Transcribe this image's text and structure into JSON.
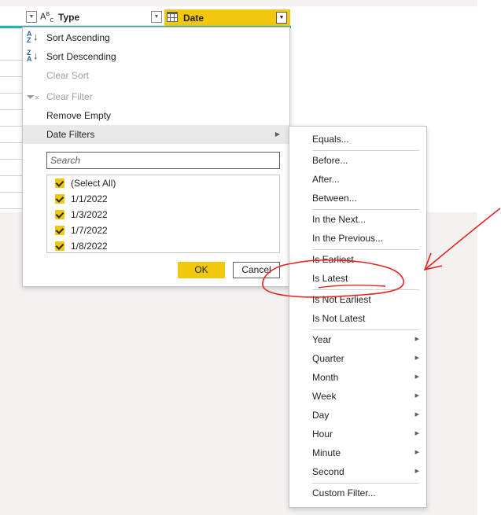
{
  "columns": {
    "type": {
      "label": "Type",
      "icon": "abc-text-type-icon"
    },
    "date": {
      "label": "Date",
      "icon": "calendar-icon"
    }
  },
  "menu": {
    "sort_ascending": "Sort Ascending",
    "sort_descending": "Sort Descending",
    "clear_sort": "Clear Sort",
    "clear_filter": "Clear Filter",
    "remove_empty": "Remove Empty",
    "date_filters": "Date Filters",
    "search_placeholder": "Search",
    "checklist": [
      "(Select All)",
      "1/1/2022",
      "1/3/2022",
      "1/7/2022",
      "1/8/2022"
    ],
    "ok": "OK",
    "cancel": "Cancel"
  },
  "submenu": {
    "items": [
      "Equals...",
      "Before...",
      "After...",
      "Between...",
      "In the Next...",
      "In the Previous...",
      "Is Earliest",
      "Is Latest",
      "Is Not Earliest",
      "Is Not Latest",
      "Year",
      "Quarter",
      "Month",
      "Week",
      "Day",
      "Hour",
      "Minute",
      "Second",
      "Custom Filter..."
    ]
  },
  "colors": {
    "accent_yellow": "#f2c80f",
    "teal": "#1fb6b4",
    "annotation_red": "#e8231f"
  }
}
